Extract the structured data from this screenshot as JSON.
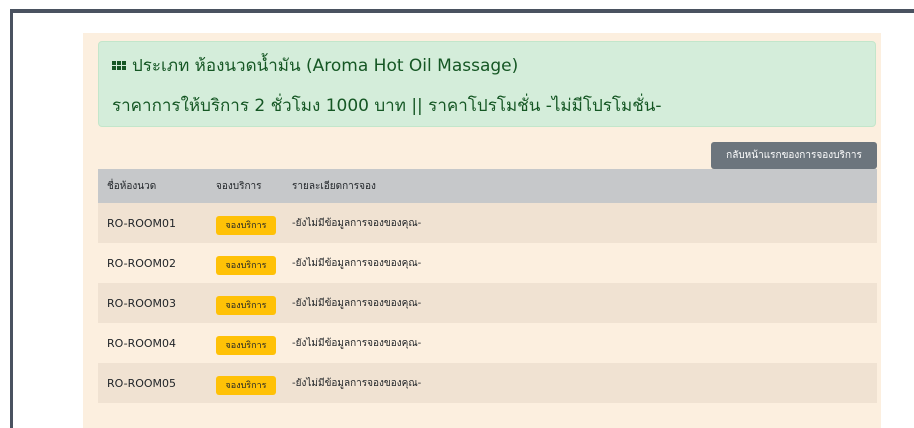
{
  "header": {
    "room_type_line": "ประเภท ห้องนวดน้ำมัน (Aroma Hot Oil Massage)",
    "price_line": "ราคาการให้บริการ 2 ชั่วโมง 1000 บาท || ราคาโปรโมชั่น -ไม่มีโปรโมชั่น-"
  },
  "back_button_label": "กลับหน้าแรกของการจองบริการ",
  "table": {
    "headers": [
      "ชื่อห้องนวด",
      "จองบริการ",
      "รายละเอียดการจอง"
    ],
    "rows": [
      {
        "room": "RO-ROOM01",
        "action": "จองบริการ",
        "detail": "-ยังไม่มีข้อมูลการจองของคุณ-"
      },
      {
        "room": "RO-ROOM02",
        "action": "จองบริการ",
        "detail": "-ยังไม่มีข้อมูลการจองของคุณ-"
      },
      {
        "room": "RO-ROOM03",
        "action": "จองบริการ",
        "detail": "-ยังไม่มีข้อมูลการจองของคุณ-"
      },
      {
        "room": "RO-ROOM04",
        "action": "จองบริการ",
        "detail": "-ยังไม่มีข้อมูลการจองของคุณ-"
      },
      {
        "room": "RO-ROOM05",
        "action": "จองบริการ",
        "detail": "-ยังไม่มีข้อมูลการจองของคุณ-"
      }
    ]
  },
  "icons": {
    "header_icon": "grid-icon"
  },
  "colors": {
    "alert_bg": "#d4edda",
    "alert_text": "#155724",
    "panel_bg": "#fcefdf",
    "back_button": "#6c757d",
    "book_button": "#ffc107",
    "table_header": "#c6c8ca"
  }
}
